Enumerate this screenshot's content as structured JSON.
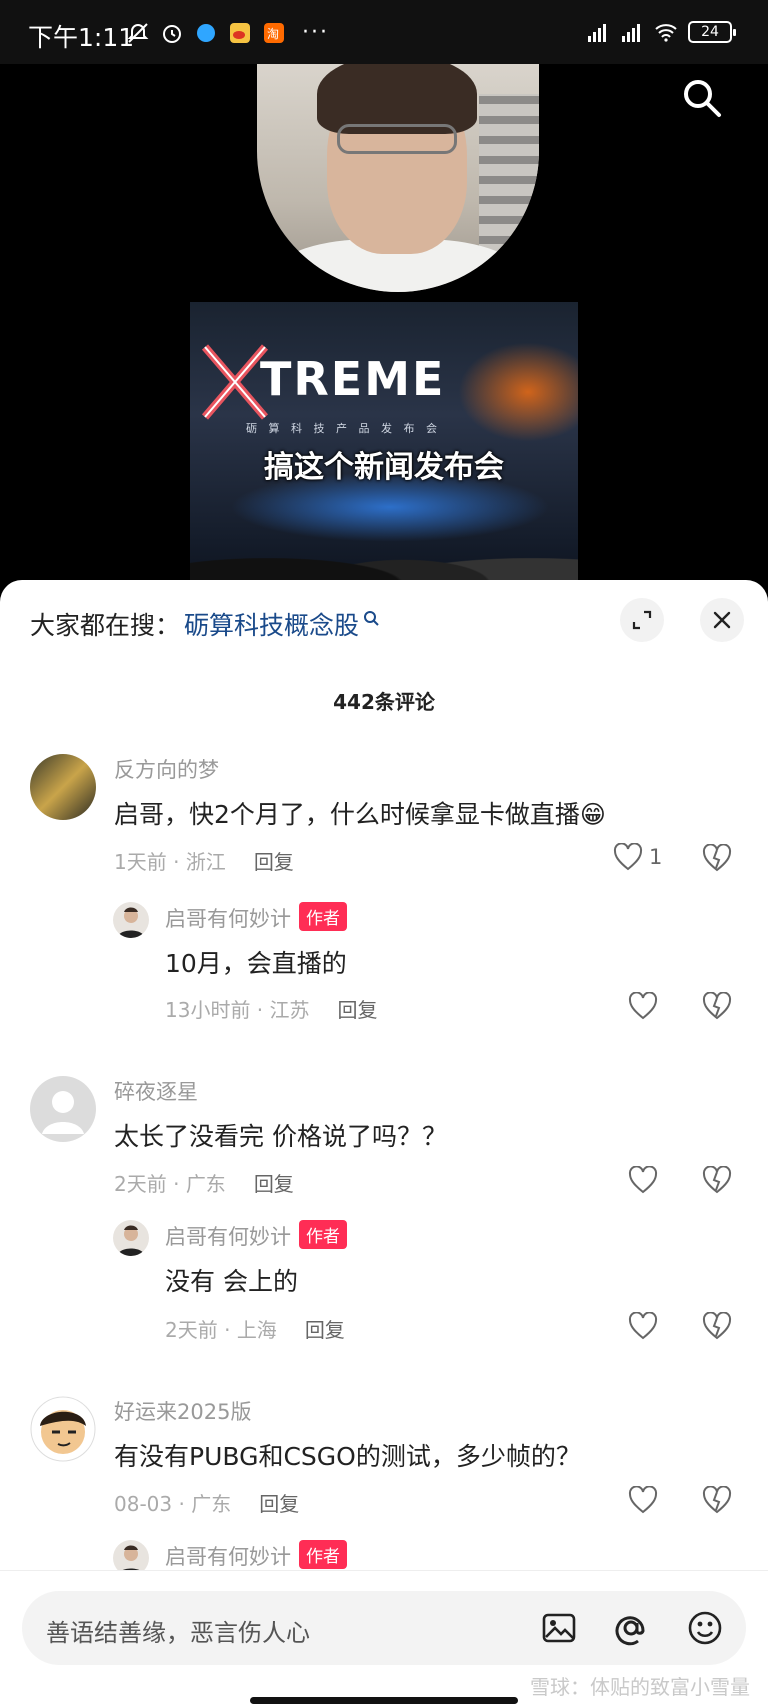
{
  "status_bar": {
    "time": "下午1:11",
    "battery": "24",
    "dots": "···"
  },
  "video": {
    "brand_text": "TREME",
    "brand_sub": "砺 算 科 技 产 品 发 布 会",
    "subtitle": "搞这个新闻发布会"
  },
  "search_bar": {
    "prefix": "大家都在搜：",
    "term": "砺算科技概念股"
  },
  "comments_header": {
    "count": "442条评论"
  },
  "comments": [
    {
      "name": "反方向的梦",
      "text": "启哥，快2个月了，什么时候拿显卡做直播😁",
      "time": "1天前",
      "location": "浙江",
      "reply_label": "回复",
      "likes": "1",
      "reply": {
        "name": "启哥有何妙计",
        "badge": "作者",
        "text": "10月，会直播的",
        "time": "13小时前",
        "location": "江苏",
        "reply_label": "回复"
      }
    },
    {
      "name": "碎夜逐星",
      "text": "太长了没看完 价格说了吗？？",
      "time": "2天前",
      "location": "广东",
      "reply_label": "回复",
      "likes": "",
      "reply": {
        "name": "启哥有何妙计",
        "badge": "作者",
        "text": "没有 会上的",
        "time": "2天前",
        "location": "上海",
        "reply_label": "回复"
      }
    },
    {
      "name": "好运来2025版",
      "text": "有没有PUBG和CSGO的测试，多少帧的？",
      "time": "08-03",
      "location": "广东",
      "reply_label": "回复",
      "likes": "",
      "reply": {
        "name": "启哥有何妙计",
        "badge": "作者"
      }
    }
  ],
  "input": {
    "placeholder": "善语结善缘，恶言伤人心"
  },
  "watermark": "雪球：体贴的致富小雪量",
  "colors": {
    "accent": "#ff2d55",
    "search_term": "#1a4a8a"
  }
}
